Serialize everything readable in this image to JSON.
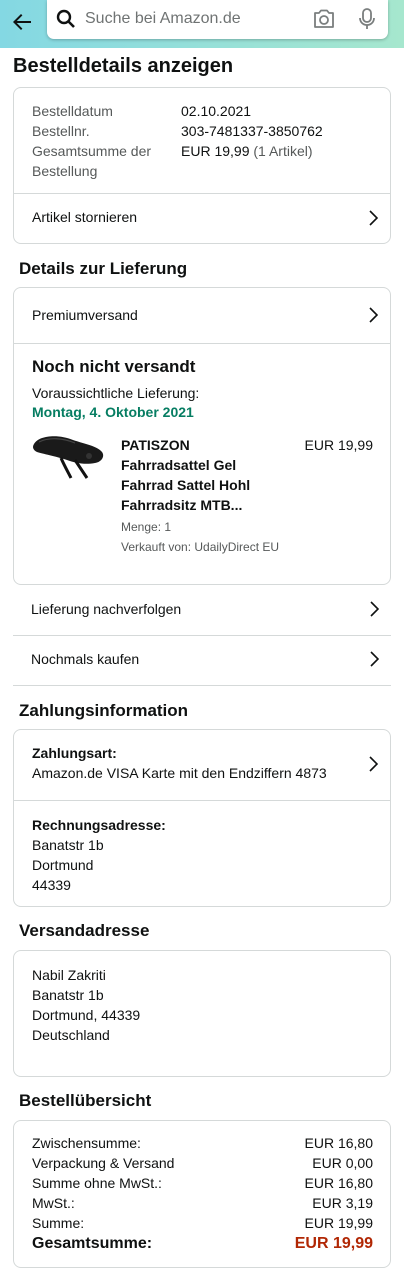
{
  "header": {
    "search_placeholder": "Suche bei Amazon.de"
  },
  "page_title": "Bestelldetails anzeigen",
  "order": {
    "date_label": "Bestelldatum",
    "date_value": "02.10.2021",
    "number_label": "Bestellnr.",
    "number_value": "303-7481337-3850762",
    "total_label_1": "Gesamtsumme der",
    "total_label_2": "Bestellung",
    "total_value": "EUR 19,99",
    "total_count": "(1 Artikel)",
    "cancel_label": "Artikel stornieren"
  },
  "delivery": {
    "heading": "Details zur Lieferung",
    "shipping_type": "Premiumversand",
    "status": "Noch nicht versandt",
    "expected_label": "Voraussichtliche Lieferung:",
    "expected_date": "Montag, 4. Oktober 2021",
    "item": {
      "title_1": "PATISZON",
      "title_2": "Fahrradsattel Gel",
      "title_3": "Fahrrad Sattel Hohl",
      "title_4": "Fahrradsitz MTB...",
      "price": "EUR 19,99",
      "quantity": "Menge: 1",
      "seller": "Verkauft von: UdailyDirect EU"
    },
    "track_label": "Lieferung nachverfolgen",
    "buy_again_label": "Nochmals kaufen"
  },
  "payment": {
    "heading": "Zahlungsinformation",
    "method_label": "Zahlungsart:",
    "method_value": "Amazon.de VISA Karte mit den Endziffern 4873",
    "billing_label": "Rechnungsadresse:",
    "billing_line1": "Banatstr 1b",
    "billing_line2": "Dortmund",
    "billing_line3": "44339"
  },
  "shipping_address": {
    "heading": "Versandadresse",
    "name": "Nabil Zakriti",
    "street": "Banatstr 1b",
    "city": "Dortmund, 44339",
    "country": "Deutschland"
  },
  "summary": {
    "heading": "Bestellübersicht",
    "rows": [
      {
        "label": "Zwischensumme:",
        "value": "EUR 16,80"
      },
      {
        "label": "Verpackung & Versand",
        "value": "EUR 0,00"
      },
      {
        "label": "Summe ohne MwSt.:",
        "value": "EUR 16,80"
      },
      {
        "label": "MwSt.:",
        "value": "EUR 3,19"
      },
      {
        "label": "Summe:",
        "value": "EUR 19,99"
      }
    ],
    "grand_label": "Gesamtsumme:",
    "grand_value": "EUR 19,99"
  }
}
